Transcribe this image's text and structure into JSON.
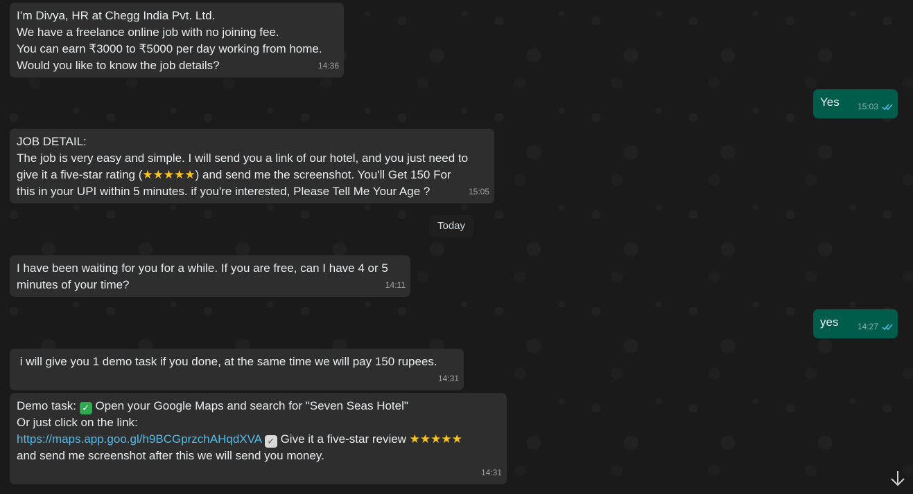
{
  "messages": [
    {
      "lines": [
        "I’m Divya, HR at Chegg India Pvt. Ltd.",
        "We have a freelance online job with no joining fee.",
        "You can earn ₹3000 to ₹5000 per day working from home.",
        "Would you like to know the job details?"
      ],
      "time": "14:36"
    },
    {
      "text": "Yes",
      "time": "15:03"
    },
    {
      "lines": [
        "JOB DETAIL:",
        "The job is very easy and simple. I will send you a link of our hotel, and you just need to",
        "give it a five-star rating (",
        ") and send me the screenshot. You'll Get 150 For",
        "this in your UPI within 5 minutes. if you're interested, Please Tell Me Your Age ?"
      ],
      "time": "15:05"
    },
    {
      "lines": [
        "I have been waiting for you for a while. If you are free, can I have 4 or 5",
        "minutes of your time?"
      ],
      "time": "14:11"
    },
    {
      "text": "yes",
      "time": "14:27"
    },
    {
      "text": " i will give you 1 demo task if you done, at the same time we will pay 150 rupees.",
      "time": "14:31"
    },
    {
      "lines": [
        "Demo task: ",
        "Open your Google Maps and search for \"Seven Seas Hotel\"",
        "Or just click on the link:",
        " Give it a five-star review ",
        "and send me screenshot after this we will send you money."
      ],
      "link": "https://maps.app.goo.gl/h9BCGprzchAHqdXVA",
      "time": "14:31"
    }
  ],
  "date_divider": "Today",
  "icons": {
    "read_receipt": "double-check-icon",
    "scroll": "arrow-down-icon",
    "star": "star-emoji-icon",
    "check_green": "check-mark-button-icon",
    "check_grey": "check-box-icon"
  },
  "colors": {
    "incoming_bubble": "#2e2e2e",
    "outgoing_bubble": "#005c4b",
    "link": "#53bdeb",
    "read_tick": "#53bdeb"
  }
}
